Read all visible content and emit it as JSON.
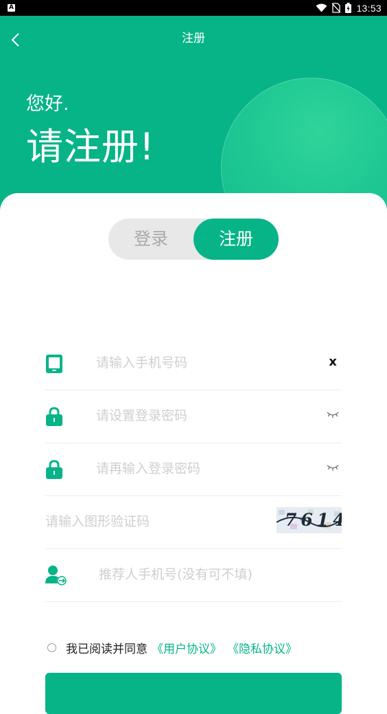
{
  "status_bar": {
    "time": "13:53",
    "app_badge": "A"
  },
  "nav": {
    "title": "注册"
  },
  "hero": {
    "greeting": "您好.",
    "headline": "请注册!"
  },
  "tabs": {
    "login": "登录",
    "register": "注册",
    "active": "register"
  },
  "form": {
    "phone": {
      "placeholder": "请输入手机号码",
      "clear_label": "x"
    },
    "password": {
      "placeholder": "请设置登录密码"
    },
    "password_confirm": {
      "placeholder": "请再输入登录密码"
    },
    "captcha": {
      "placeholder": "请输入图形验证码",
      "image_text": "7614"
    },
    "referrer": {
      "placeholder": "推荐人手机号(没有可不填)"
    }
  },
  "agreement": {
    "text": "我已阅读并同意",
    "user_agreement": "《用户协议》",
    "privacy_policy": "《隐私协议》"
  },
  "colors": {
    "primary": "#06b487",
    "placeholder": "#cfcfcf",
    "divider": "#ececec"
  }
}
